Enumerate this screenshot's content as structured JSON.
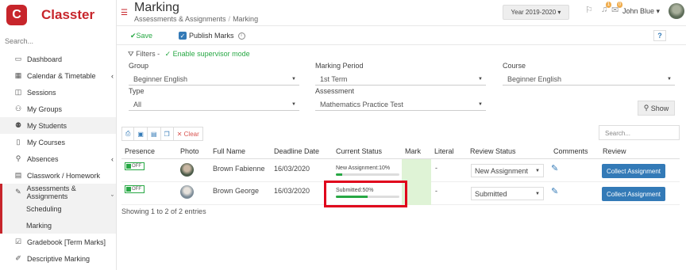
{
  "app": {
    "name": "Classter",
    "logo_glyph": "C"
  },
  "sidebar": {
    "search_placeholder": "Search...",
    "items": [
      {
        "label": "Dashboard",
        "icon": "laptop-icon"
      },
      {
        "label": "Calendar & Timetable",
        "icon": "calendar-icon",
        "chevron": "‹"
      },
      {
        "label": "Sessions",
        "icon": "sessions-icon"
      },
      {
        "label": "My Groups",
        "icon": "groups-icon"
      },
      {
        "label": "My Students",
        "icon": "students-icon"
      },
      {
        "label": "My Courses",
        "icon": "book-icon"
      },
      {
        "label": "Absences",
        "icon": "absence-icon",
        "chevron": "‹"
      },
      {
        "label": "Classwork / Homework",
        "icon": "list-icon"
      },
      {
        "label": "Assessments & Assignments",
        "icon": "edit-icon",
        "chevron": "ˇ"
      },
      {
        "label": "Scheduling"
      },
      {
        "label": "Marking"
      },
      {
        "label": "Gradebook [Term Marks]",
        "icon": "check-icon"
      },
      {
        "label": "Descriptive Marking",
        "icon": "pen-icon"
      }
    ]
  },
  "header": {
    "title": "Marking",
    "breadcrumb": [
      "Assessments & Assignments",
      "Marking"
    ],
    "year": "Year 2019-2020",
    "notifications_count": "1",
    "messages_count": "0",
    "user": "John Blue"
  },
  "toolbar": {
    "save_label": "Save",
    "publish_label": "Publish Marks",
    "help_label": "?"
  },
  "filters": {
    "label": "Filters",
    "supervisor_label": "Enable supervisor mode",
    "group_label": "Group",
    "group_value": "Beginner English",
    "marking_period_label": "Marking Period",
    "marking_period_value": "1st Term",
    "course_label": "Course",
    "course_value": "Beginner English",
    "type_label": "Type",
    "type_value": "All",
    "assessment_label": "Assessment",
    "assessment_value": "Mathematics Practice Test",
    "show_label": "Show"
  },
  "table": {
    "clear_label": "Clear",
    "search_placeholder": "Search...",
    "columns": [
      "Presence",
      "Photo",
      "Full Name",
      "Deadline Date",
      "Current Status",
      "Mark",
      "Literal",
      "Review Status",
      "Comments",
      "Review"
    ],
    "rows": [
      {
        "presence": "OFF",
        "name": "Brown Fabienne",
        "deadline": "16/03/2020",
        "status": "New Assignment:10%",
        "progress": 0.1,
        "mark": "",
        "literal": "-",
        "review_status": "New Assignment",
        "action": "Collect Assignment"
      },
      {
        "presence": "OFF",
        "name": "Brown George",
        "deadline": "16/03/2020",
        "status": "Submitted:50%",
        "progress": 0.5,
        "mark": "",
        "literal": "-",
        "review_status": "Submitted",
        "action": "Collect Assignment"
      }
    ],
    "footer": "Showing 1 to 2 of 2 entries"
  },
  "colors": {
    "brand": "#c7252b",
    "accent": "#337ab7",
    "success": "#27a844",
    "highlight": "#e0001b"
  }
}
